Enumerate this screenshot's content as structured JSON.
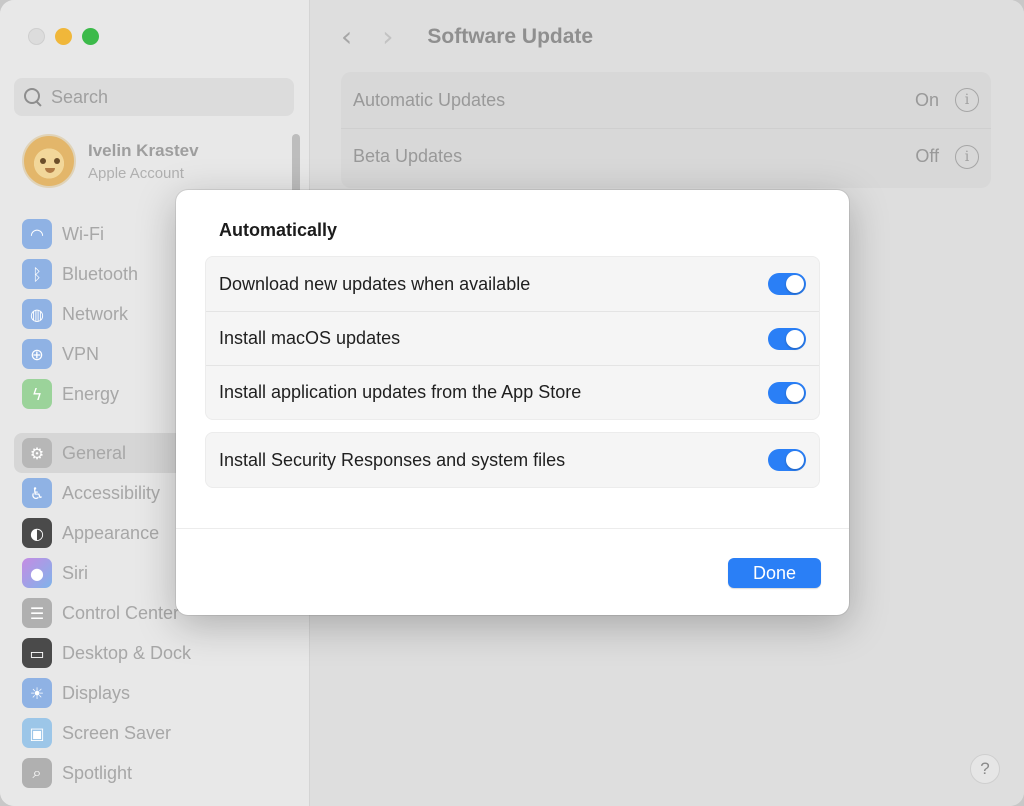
{
  "sidebar": {
    "search_placeholder": "Search",
    "account": {
      "name": "Ivelin Krastev",
      "subtitle": "Apple Account"
    },
    "items_top": [
      {
        "label": "Wi-Fi",
        "icon": "wifi-icon"
      },
      {
        "label": "Bluetooth",
        "icon": "bluetooth-icon"
      },
      {
        "label": "Network",
        "icon": "network-icon"
      },
      {
        "label": "VPN",
        "icon": "vpn-icon"
      },
      {
        "label": "Energy",
        "icon": "energy-icon"
      }
    ],
    "items_bottom": [
      {
        "label": "General",
        "icon": "gear-icon",
        "selected": true
      },
      {
        "label": "Accessibility",
        "icon": "accessibility-icon"
      },
      {
        "label": "Appearance",
        "icon": "appearance-icon"
      },
      {
        "label": "Siri",
        "icon": "siri-icon"
      },
      {
        "label": "Control Center",
        "icon": "control-center-icon"
      },
      {
        "label": "Desktop & Dock",
        "icon": "dock-icon"
      },
      {
        "label": "Displays",
        "icon": "displays-icon"
      },
      {
        "label": "Screen Saver",
        "icon": "screen-saver-icon"
      },
      {
        "label": "Spotlight",
        "icon": "spotlight-icon"
      }
    ]
  },
  "main": {
    "title": "Software Update",
    "settings": [
      {
        "label": "Automatic Updates",
        "value": "On"
      },
      {
        "label": "Beta Updates",
        "value": "Off"
      }
    ]
  },
  "sheet": {
    "heading": "Automatically",
    "group1": [
      {
        "label": "Download new updates when available",
        "on": true
      },
      {
        "label": "Install macOS updates",
        "on": true
      },
      {
        "label": "Install application updates from the App Store",
        "on": true
      }
    ],
    "group2": [
      {
        "label": "Install Security Responses and system files",
        "on": true
      }
    ],
    "done_label": "Done"
  },
  "colors": {
    "accent": "#2a7ff6"
  }
}
